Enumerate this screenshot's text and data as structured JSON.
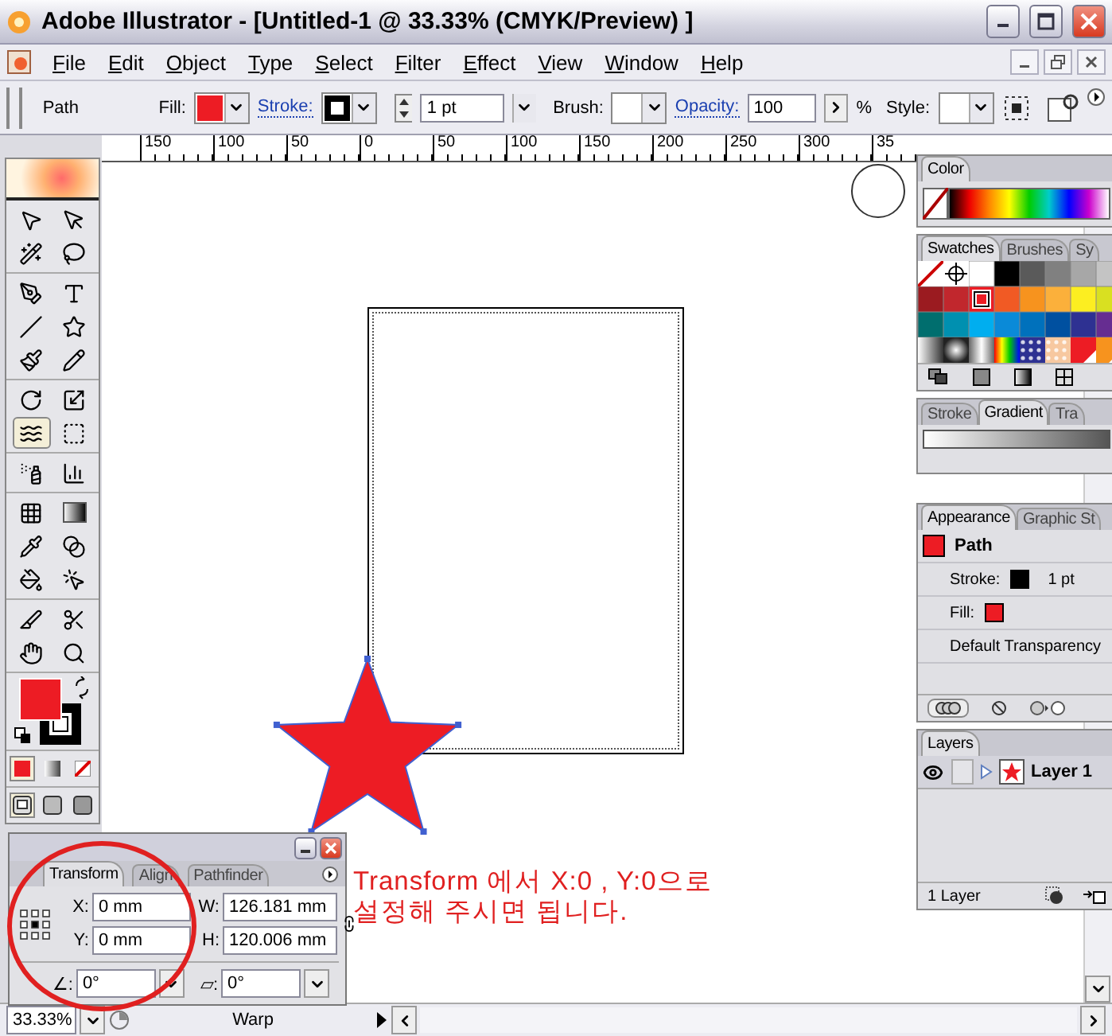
{
  "window": {
    "title": "Adobe Illustrator - [Untitled-1 @ 33.33% (CMYK/Preview) ]"
  },
  "menu": [
    "File",
    "Edit",
    "Object",
    "Type",
    "Select",
    "Filter",
    "Effect",
    "View",
    "Window",
    "Help"
  ],
  "control_bar": {
    "selection": "Path",
    "fill_label": "Fill:",
    "stroke_label": "Stroke:",
    "stroke_weight": "1 pt",
    "brush_label": "Brush:",
    "opacity_label": "Opacity:",
    "opacity": "100",
    "percent": "%",
    "style_label": "Style:"
  },
  "ruler": [
    "150",
    "100",
    "50",
    "0",
    "50",
    "100",
    "150",
    "200",
    "250",
    "300",
    "35"
  ],
  "toolbox": {
    "groups": [
      [
        {
          "kind": "select",
          "selected": false
        },
        {
          "kind": "direct-select",
          "selected": false
        },
        {
          "kind": "magic-wand",
          "selected": false
        },
        {
          "kind": "lasso",
          "selected": false
        }
      ],
      [
        {
          "kind": "pen",
          "selected": false
        },
        {
          "kind": "type",
          "selected": false
        },
        {
          "kind": "line",
          "selected": false
        },
        {
          "kind": "star",
          "selected": false
        },
        {
          "kind": "brush",
          "selected": false
        },
        {
          "kind": "pencil",
          "selected": false
        }
      ],
      [
        {
          "kind": "rotate",
          "selected": false
        },
        {
          "kind": "scale",
          "selected": false
        },
        {
          "kind": "warp",
          "selected": true
        },
        {
          "kind": "free-transform",
          "selected": false
        }
      ],
      [
        {
          "kind": "spray",
          "selected": false
        },
        {
          "kind": "graph",
          "selected": false
        }
      ],
      [
        {
          "kind": "mesh",
          "selected": false
        },
        {
          "kind": "gradient",
          "selected": false
        },
        {
          "kind": "eyedropper",
          "selected": false
        },
        {
          "kind": "blend",
          "selected": false
        },
        {
          "kind": "paint-bucket",
          "selected": false
        },
        {
          "kind": "paint-select",
          "selected": false
        }
      ],
      [
        {
          "kind": "slice",
          "selected": false
        },
        {
          "kind": "scissors",
          "selected": false
        },
        {
          "kind": "hand",
          "selected": false
        },
        {
          "kind": "zoom",
          "selected": false
        }
      ]
    ],
    "color_modes": [
      {
        "kind": "color",
        "selected": true
      },
      {
        "kind": "gradient",
        "selected": false
      },
      {
        "kind": "none",
        "selected": false
      }
    ],
    "screen_modes": [
      {
        "kind": "standard",
        "selected": true
      },
      {
        "kind": "menu",
        "selected": false
      },
      {
        "kind": "full",
        "selected": false
      }
    ]
  },
  "color_panel": {
    "tab": "Color"
  },
  "swatches_panel": {
    "tabs": [
      {
        "label": "Swatches",
        "selected": true
      },
      {
        "label": "Brushes",
        "selected": false
      },
      {
        "label": "Sy",
        "selected": false
      }
    ],
    "swatches": [
      {
        "kind": "none",
        "selected": false
      },
      {
        "kind": "registration",
        "selected": false
      },
      {
        "kind": "color",
        "color": "#ffffff",
        "selected": false
      },
      {
        "kind": "color",
        "color": "#000000",
        "selected": false
      },
      {
        "kind": "color",
        "color": "#5a5a5a",
        "selected": false
      },
      {
        "kind": "color",
        "color": "#808080",
        "selected": false
      },
      {
        "kind": "color",
        "color": "#a7a7a7",
        "selected": false
      },
      {
        "kind": "color",
        "color": "#c4c4c4",
        "selected": false
      },
      {
        "kind": "color",
        "color": "#9b1b20",
        "selected": false
      },
      {
        "kind": "color",
        "color": "#c1272d",
        "selected": false
      },
      {
        "kind": "color",
        "color": "#ed1c24",
        "selected": true
      },
      {
        "kind": "color",
        "color": "#f15a24",
        "selected": false
      },
      {
        "kind": "color",
        "color": "#f7931e",
        "selected": false
      },
      {
        "kind": "color",
        "color": "#fbb03b",
        "selected": false
      },
      {
        "kind": "color",
        "color": "#fcee21",
        "selected": false
      },
      {
        "kind": "color",
        "color": "#d9e021",
        "selected": false
      },
      {
        "kind": "color",
        "color": "#006e6e",
        "selected": false
      },
      {
        "kind": "color",
        "color": "#0090b0",
        "selected": false
      },
      {
        "kind": "color",
        "color": "#00aeef",
        "selected": false
      },
      {
        "kind": "color",
        "color": "#0a8ad8",
        "selected": false
      },
      {
        "kind": "color",
        "color": "#0071bc",
        "selected": false
      },
      {
        "kind": "color",
        "color": "#0050a0",
        "selected": false
      },
      {
        "kind": "color",
        "color": "#2e3192",
        "selected": false
      },
      {
        "kind": "color",
        "color": "#662d91",
        "selected": false
      },
      {
        "kind": "linear",
        "selected": false
      },
      {
        "kind": "radial",
        "selected": false
      },
      {
        "kind": "stripes",
        "selected": false
      },
      {
        "kind": "rainbow",
        "selected": false
      },
      {
        "kind": "pattern",
        "color": "#2e3192",
        "selected": false
      },
      {
        "kind": "pattern",
        "color": "#f7c8a0",
        "selected": false
      },
      {
        "kind": "split",
        "color": "#ed1c24",
        "selected": false
      },
      {
        "kind": "split",
        "color": "#f7931e",
        "selected": false
      }
    ]
  },
  "gradient_panel": {
    "tabs": [
      {
        "label": "Stroke",
        "selected": false
      },
      {
        "label": "Gradient",
        "selected": true
      },
      {
        "label": "Tra",
        "selected": false
      }
    ]
  },
  "appearance_panel": {
    "tabs": [
      {
        "label": "Appearance",
        "selected": true
      },
      {
        "label": "Graphic St",
        "selected": false
      }
    ],
    "object": "Path",
    "rows": [
      {
        "kind": "swatch",
        "label": "Stroke:",
        "color": "#000000",
        "value": "1 pt"
      },
      {
        "kind": "swatch",
        "label": "Fill:",
        "color": "#ed1c24"
      },
      {
        "kind": "text",
        "label": "Default Transparency"
      }
    ]
  },
  "layers_panel": {
    "tab": "Layers",
    "layers": [
      {
        "name": "Layer 1",
        "visible": true,
        "expanded": false
      }
    ],
    "footer": "1 Layer"
  },
  "transform_panel": {
    "tabs": [
      {
        "label": "Transform",
        "selected": true
      },
      {
        "label": "Align",
        "selected": false
      },
      {
        "label": "Pathfinder",
        "selected": false
      }
    ],
    "fields": [
      {
        "label": "X:",
        "value": "0 mm"
      },
      {
        "label": "W:",
        "value": "126.181 mm"
      },
      {
        "label": "Y:",
        "value": "0 mm"
      },
      {
        "label": "H:",
        "value": "120.006 mm"
      }
    ],
    "rotate_label": "∠:",
    "rotate": "0°",
    "shear_label": "▱:",
    "shear": "0°"
  },
  "annotation": [
    "Transform 에서  X:0 , Y:0으로",
    "설정해 주시면 됩니다."
  ],
  "status_bar": {
    "zoom": "33.33%",
    "tool": "Warp"
  }
}
